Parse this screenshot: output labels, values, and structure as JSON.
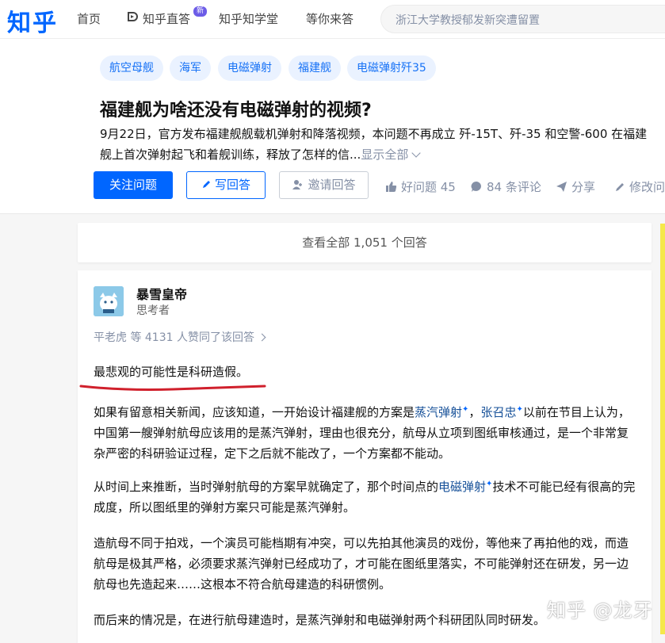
{
  "nav": {
    "logo": "知乎",
    "items": [
      "首页",
      "知乎直答",
      "知乎知学堂",
      "等你来答"
    ],
    "badge": "新",
    "search_text": "浙江大学教授郁发新突遭留置"
  },
  "question": {
    "tags": [
      "航空母舰",
      "海军",
      "电磁弹射",
      "福建舰",
      "电磁弹射歼35"
    ],
    "title": "福建舰为啥还没有电磁弹射的视频?",
    "detail": "9月22日，官方发布福建舰舰载机弹射和降落视频，本问题不再成立 歼-15T、歼-35 和空警-600 在福建舰上首次弹射起飞和着舰训练，释放了怎样的信...",
    "show_all": "显示全部",
    "follow_btn": "关注问题",
    "write_btn": "写回答",
    "invite_btn": "邀请回答",
    "good_question": "好问题 45",
    "comments": "84 条评论",
    "share": "分享",
    "edit": "修改问"
  },
  "view_all": "查看全部 1,051 个回答",
  "answer": {
    "author": "暴雪皇帝",
    "headline": "思考者",
    "voters": "平老虎 等 4131 人赞同了该回答",
    "p1": "最悲观的可能性是科研造假。",
    "p2_a": "如果有留意相关新闻，应该知道，一开始设计福建舰的方案是",
    "p2_kw1": "蒸汽弹射",
    "p2_sep": "，",
    "p2_kw2": "张召忠",
    "p2_b": "以前在节目上认为，中国第一艘弹射航母应该用的是蒸汽弹射，理由也很充分，航母从立项到图纸审核通过，是一个非常复杂严密的科研验证过程，定下之后就不能改了，一个方案都不能动。",
    "p3_a": "从时间上来推断，当时弹射航母的方案早就确定了，那个时间点的",
    "p3_kw": "电磁弹射",
    "p3_b": "技术不可能已经有很高的完成度，所以图纸里的弹射方案只可能是蒸汽弹射。",
    "p4": "造航母不同于拍戏，一个演员可能档期有冲突，可以先拍其他演员的戏份，等他来了再拍他的戏，而造航母是极其严格，必须要求蒸汽弹射已经成功了，才可能在图纸里落实，不可能弹射还在研发，另一边航母也先造起来……这根本不符合航母建造的科研惯例。",
    "p5": "而后来的情况是，在进行航母建造时，是蒸汽弹射和电磁弹射两个科研团队同时研发。"
  },
  "watermark": "知乎 @龙牙",
  "colors": {
    "brand": "#0066ff",
    "link": "#175199",
    "underline": "#d0202c"
  }
}
